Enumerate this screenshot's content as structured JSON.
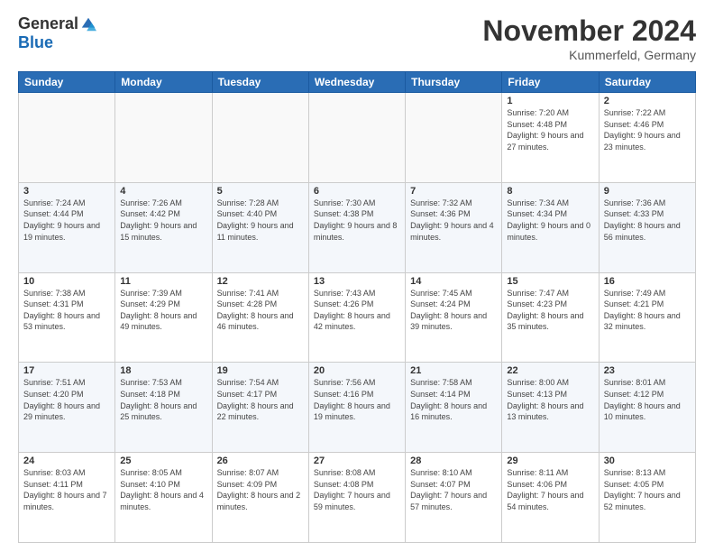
{
  "logo": {
    "general": "General",
    "blue": "Blue"
  },
  "title": "November 2024",
  "subtitle": "Kummerfeld, Germany",
  "headers": [
    "Sunday",
    "Monday",
    "Tuesday",
    "Wednesday",
    "Thursday",
    "Friday",
    "Saturday"
  ],
  "rows": [
    [
      {
        "day": "",
        "info": ""
      },
      {
        "day": "",
        "info": ""
      },
      {
        "day": "",
        "info": ""
      },
      {
        "day": "",
        "info": ""
      },
      {
        "day": "",
        "info": ""
      },
      {
        "day": "1",
        "info": "Sunrise: 7:20 AM\nSunset: 4:48 PM\nDaylight: 9 hours and 27 minutes."
      },
      {
        "day": "2",
        "info": "Sunrise: 7:22 AM\nSunset: 4:46 PM\nDaylight: 9 hours and 23 minutes."
      }
    ],
    [
      {
        "day": "3",
        "info": "Sunrise: 7:24 AM\nSunset: 4:44 PM\nDaylight: 9 hours and 19 minutes."
      },
      {
        "day": "4",
        "info": "Sunrise: 7:26 AM\nSunset: 4:42 PM\nDaylight: 9 hours and 15 minutes."
      },
      {
        "day": "5",
        "info": "Sunrise: 7:28 AM\nSunset: 4:40 PM\nDaylight: 9 hours and 11 minutes."
      },
      {
        "day": "6",
        "info": "Sunrise: 7:30 AM\nSunset: 4:38 PM\nDaylight: 9 hours and 8 minutes."
      },
      {
        "day": "7",
        "info": "Sunrise: 7:32 AM\nSunset: 4:36 PM\nDaylight: 9 hours and 4 minutes."
      },
      {
        "day": "8",
        "info": "Sunrise: 7:34 AM\nSunset: 4:34 PM\nDaylight: 9 hours and 0 minutes."
      },
      {
        "day": "9",
        "info": "Sunrise: 7:36 AM\nSunset: 4:33 PM\nDaylight: 8 hours and 56 minutes."
      }
    ],
    [
      {
        "day": "10",
        "info": "Sunrise: 7:38 AM\nSunset: 4:31 PM\nDaylight: 8 hours and 53 minutes."
      },
      {
        "day": "11",
        "info": "Sunrise: 7:39 AM\nSunset: 4:29 PM\nDaylight: 8 hours and 49 minutes."
      },
      {
        "day": "12",
        "info": "Sunrise: 7:41 AM\nSunset: 4:28 PM\nDaylight: 8 hours and 46 minutes."
      },
      {
        "day": "13",
        "info": "Sunrise: 7:43 AM\nSunset: 4:26 PM\nDaylight: 8 hours and 42 minutes."
      },
      {
        "day": "14",
        "info": "Sunrise: 7:45 AM\nSunset: 4:24 PM\nDaylight: 8 hours and 39 minutes."
      },
      {
        "day": "15",
        "info": "Sunrise: 7:47 AM\nSunset: 4:23 PM\nDaylight: 8 hours and 35 minutes."
      },
      {
        "day": "16",
        "info": "Sunrise: 7:49 AM\nSunset: 4:21 PM\nDaylight: 8 hours and 32 minutes."
      }
    ],
    [
      {
        "day": "17",
        "info": "Sunrise: 7:51 AM\nSunset: 4:20 PM\nDaylight: 8 hours and 29 minutes."
      },
      {
        "day": "18",
        "info": "Sunrise: 7:53 AM\nSunset: 4:18 PM\nDaylight: 8 hours and 25 minutes."
      },
      {
        "day": "19",
        "info": "Sunrise: 7:54 AM\nSunset: 4:17 PM\nDaylight: 8 hours and 22 minutes."
      },
      {
        "day": "20",
        "info": "Sunrise: 7:56 AM\nSunset: 4:16 PM\nDaylight: 8 hours and 19 minutes."
      },
      {
        "day": "21",
        "info": "Sunrise: 7:58 AM\nSunset: 4:14 PM\nDaylight: 8 hours and 16 minutes."
      },
      {
        "day": "22",
        "info": "Sunrise: 8:00 AM\nSunset: 4:13 PM\nDaylight: 8 hours and 13 minutes."
      },
      {
        "day": "23",
        "info": "Sunrise: 8:01 AM\nSunset: 4:12 PM\nDaylight: 8 hours and 10 minutes."
      }
    ],
    [
      {
        "day": "24",
        "info": "Sunrise: 8:03 AM\nSunset: 4:11 PM\nDaylight: 8 hours and 7 minutes."
      },
      {
        "day": "25",
        "info": "Sunrise: 8:05 AM\nSunset: 4:10 PM\nDaylight: 8 hours and 4 minutes."
      },
      {
        "day": "26",
        "info": "Sunrise: 8:07 AM\nSunset: 4:09 PM\nDaylight: 8 hours and 2 minutes."
      },
      {
        "day": "27",
        "info": "Sunrise: 8:08 AM\nSunset: 4:08 PM\nDaylight: 7 hours and 59 minutes."
      },
      {
        "day": "28",
        "info": "Sunrise: 8:10 AM\nSunset: 4:07 PM\nDaylight: 7 hours and 57 minutes."
      },
      {
        "day": "29",
        "info": "Sunrise: 8:11 AM\nSunset: 4:06 PM\nDaylight: 7 hours and 54 minutes."
      },
      {
        "day": "30",
        "info": "Sunrise: 8:13 AM\nSunset: 4:05 PM\nDaylight: 7 hours and 52 minutes."
      }
    ]
  ]
}
